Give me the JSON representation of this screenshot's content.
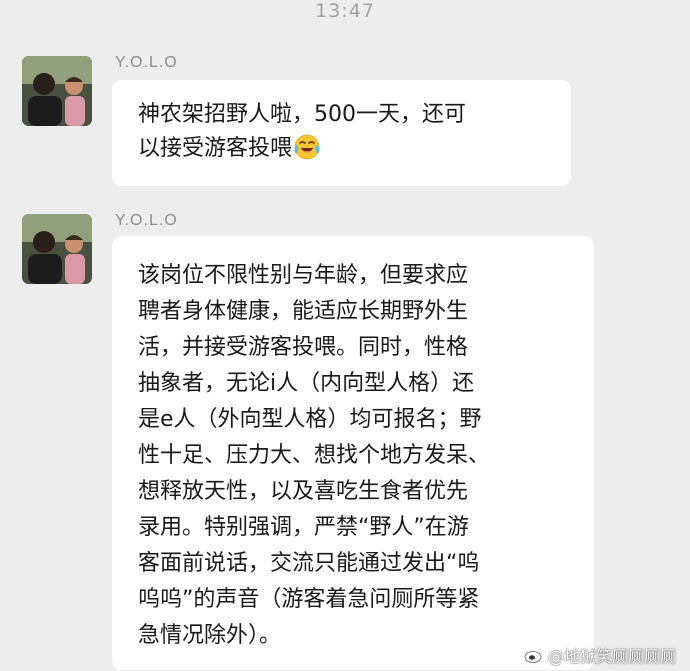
{
  "status": {
    "time": "13:47"
  },
  "messages": [
    {
      "sender": "Y.O.L.O",
      "lines": [
        "神农架招野人啦，500一天，还可",
        "以接受游客投喂"
      ],
      "emoji": "face-with-tears-of-joy"
    },
    {
      "sender": "Y.O.L.O",
      "lines": [
        "该岗位不限性别与年龄，但要求应",
        "聘者身体健康，能适应长期野外生",
        "活，并接受游客投喂。同时，性格",
        "抽象者，无论i人（内向型人格）还",
        "是e人（外向型人格）均可报名；野",
        "性十足、压力大、想找个地方发呆、",
        "想释放天性，以及喜吃生食者优先",
        "录用。特别强调，严禁“野人”在游",
        "客面前说话，交流只能通过发出“呜",
        "呜呜”的声音（游客着急问厕所等紧",
        "急情况除外）。"
      ]
    }
  ],
  "watermark": {
    "text": "@地狱笑厕厕厕厕",
    "icon": "weibo-logo-icon"
  },
  "colors": {
    "background": "#ededed",
    "bubble": "#ffffff",
    "meta_text": "#8c8c8c"
  }
}
